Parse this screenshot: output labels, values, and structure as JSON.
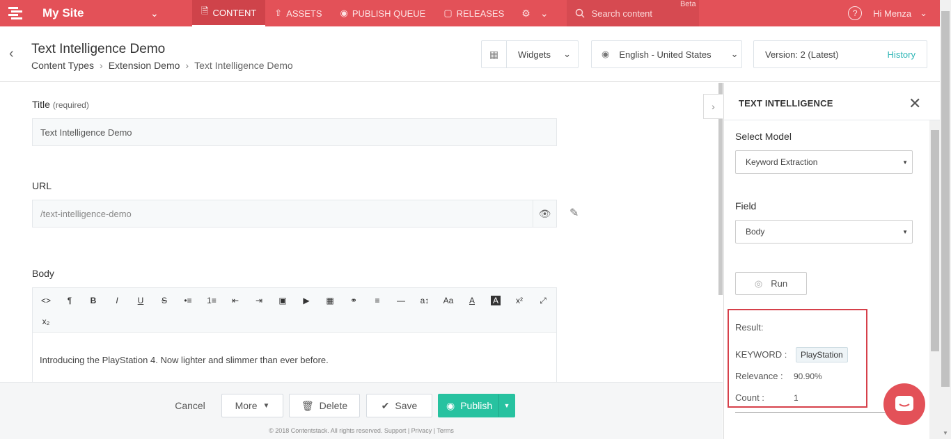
{
  "app": {
    "site_name": "My Site",
    "nav": [
      {
        "label": "CONTENT",
        "icon": "document-icon"
      },
      {
        "label": "ASSETS",
        "icon": "upload-icon"
      },
      {
        "label": "PUBLISH QUEUE",
        "icon": "globe-icon"
      },
      {
        "label": "RELEASES",
        "icon": "box-icon"
      }
    ],
    "search_placeholder": "Search content",
    "beta_label": "Beta",
    "help_label": "?",
    "user_greeting": "Hi  Menza"
  },
  "header": {
    "title": "Text Intelligence Demo",
    "breadcrumb": [
      "Content Types",
      "Extension Demo",
      "Text Intelligence Demo"
    ],
    "widgets_label": "Widgets",
    "locale_label": "English - United States",
    "version_label": "Version: 2 (Latest)",
    "history_label": "History"
  },
  "form": {
    "title_label": "Title",
    "title_required": "(required)",
    "title_value": "Text Intelligence Demo",
    "url_label": "URL",
    "url_value": "/text-intelligence-demo",
    "body_label": "Body",
    "body_text": "Introducing the PlayStation 4. Now lighter and slimmer than ever before.",
    "toolbar": [
      "<>",
      "¶",
      "B",
      "I",
      "U",
      "S",
      "•≡",
      "1≡",
      "⇤",
      "⇥",
      "▣",
      "▶",
      "▦",
      "⚭",
      "≡",
      "—",
      "a↕",
      "Aa",
      "A",
      "A",
      "x²",
      "⤢",
      "x₂"
    ]
  },
  "footer": {
    "cancel": "Cancel",
    "more": "More",
    "delete": "Delete",
    "save": "Save",
    "publish": "Publish",
    "copyright": "© 2018 Contentstack. All rights reserved. Support | Privacy | Terms"
  },
  "panel": {
    "title": "TEXT INTELLIGENCE",
    "select_model_label": "Select Model",
    "model_value": "Keyword Extraction",
    "field_label": "Field",
    "field_value": "Body",
    "run_label": "Run",
    "result_label": "Result:",
    "keyword_label": "KEYWORD :",
    "keyword_value": "PlayStation",
    "relevance_label": "Relevance :",
    "relevance_value": "90.90%",
    "count_label": "Count :",
    "count_value": "1"
  },
  "colors": {
    "brand": "#e35158",
    "publish": "#27c2a0",
    "link": "#2cb5b5",
    "highlight": "#d6404a"
  }
}
